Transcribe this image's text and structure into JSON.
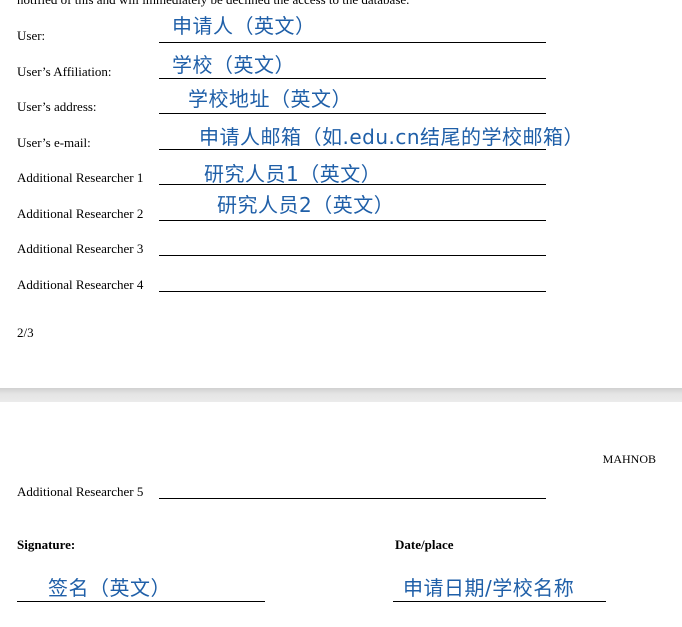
{
  "page1": {
    "cut_text": "notified of this and will immediately be declined the access to the database.",
    "fields": [
      {
        "label": "User:",
        "handwritten": "申请人（英文）"
      },
      {
        "label": "User’s Affiliation:",
        "handwritten": "学校（英文）"
      },
      {
        "label": "User’s address:",
        "handwritten": "学校地址（英文）"
      },
      {
        "label": "User’s e-mail:",
        "handwritten": "申请人邮箱（如.edu.cn结尾的学校邮箱）"
      },
      {
        "label": "Additional Researcher 1",
        "handwritten": "研究人员1（英文）"
      },
      {
        "label": "Additional Researcher 2",
        "handwritten": "研究人员2（英文）"
      },
      {
        "label": "Additional Researcher 3",
        "handwritten": ""
      },
      {
        "label": "Additional Researcher 4",
        "handwritten": ""
      }
    ],
    "page_number": "2/3"
  },
  "page2": {
    "header": "MAHNOB",
    "field5_label": "Additional Researcher 5",
    "signature_label": "Signature:",
    "date_label": "Date/place",
    "signature_value": "签名（英文）",
    "date_value": "申请日期/学校名称"
  },
  "colors": {
    "handwriting": "#1f5fa8",
    "page_gap": "#d9d9d9"
  }
}
